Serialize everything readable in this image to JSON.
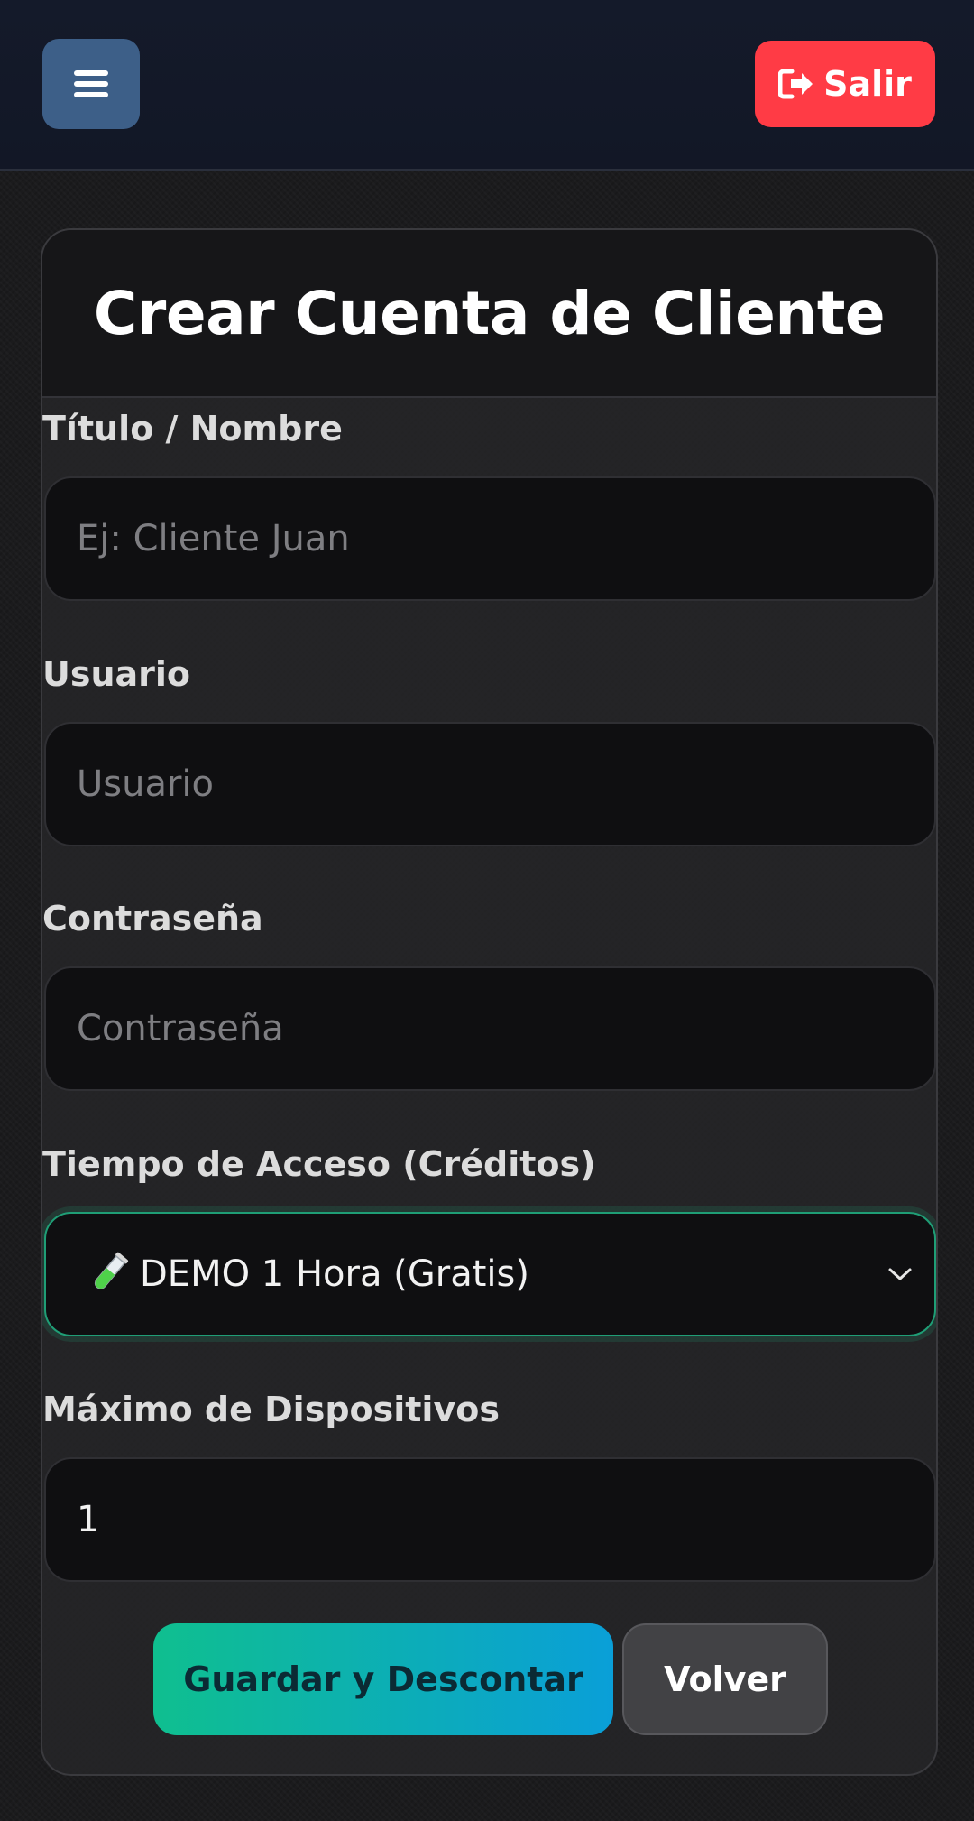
{
  "header": {
    "menu_icon": "hamburger-menu-icon",
    "logout_icon": "sign-out-icon",
    "logout_label": "Salir",
    "logout_color": "#ff3b45",
    "menu_color": "#3d5f88"
  },
  "form": {
    "title": "Crear Cuenta de Cliente",
    "fields": {
      "name": {
        "label": "Título / Nombre",
        "placeholder": "Ej: Cliente Juan",
        "value": ""
      },
      "username": {
        "label": "Usuario",
        "placeholder": "Usuario",
        "value": ""
      },
      "password": {
        "label": "Contraseña",
        "placeholder": "Contraseña",
        "value": ""
      },
      "access_time": {
        "label": "Tiempo de Acceso (Créditos)",
        "selected": "DEMO 1 Hora (Gratis)",
        "icon": "test-tube-icon"
      },
      "max_devices": {
        "label": "Máximo de Dispositivos",
        "value": "1"
      }
    },
    "buttons": {
      "save_label": "Guardar y Descontar",
      "back_label": "Volver"
    },
    "accent_colors": {
      "save_start": "#0fbf8f",
      "save_end": "#0a9fd8",
      "select_border": "#1f9e76"
    }
  }
}
